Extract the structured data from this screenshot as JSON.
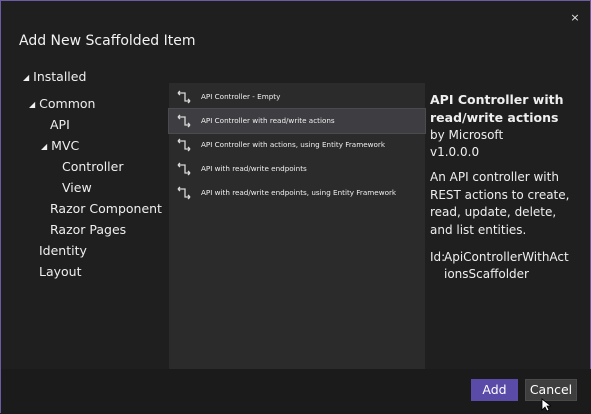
{
  "dialog": {
    "title": "Add New Scaffolded Item",
    "close_glyph": "×"
  },
  "tree": {
    "root": {
      "label": "Installed",
      "expand_glyph": "◢"
    },
    "nodes": [
      {
        "label": "Common",
        "glyph": "◢"
      },
      {
        "label": "API"
      },
      {
        "label": "MVC",
        "glyph": "◢"
      },
      {
        "label": "Controller"
      },
      {
        "label": "View"
      },
      {
        "label": "Razor Component"
      },
      {
        "label": "Razor Pages"
      },
      {
        "label": "Identity"
      },
      {
        "label": "Layout"
      }
    ]
  },
  "templates": [
    {
      "label": "API Controller - Empty",
      "icon": "controller-icon"
    },
    {
      "label": "API Controller with read/write actions",
      "icon": "controller-icon",
      "selected": true
    },
    {
      "label": "API Controller with actions, using Entity Framework",
      "icon": "controller-icon"
    },
    {
      "label": "API with read/write endpoints",
      "icon": "controller-icon"
    },
    {
      "label": "API with read/write endpoints, using Entity Framework",
      "icon": "controller-icon"
    }
  ],
  "details": {
    "title": "API Controller with read/write actions",
    "by": "by Microsoft",
    "version": "v1.0.0.0",
    "description": "An API controller with REST actions to create, read, update, delete, and list entities.",
    "id_label": "Id:",
    "id_value": "ApiControllerWithActionsScaffolder"
  },
  "buttons": {
    "add": "Add",
    "cancel": "Cancel"
  },
  "colors": {
    "accent": "#5b4ba9",
    "border": "#6d5ba8"
  }
}
